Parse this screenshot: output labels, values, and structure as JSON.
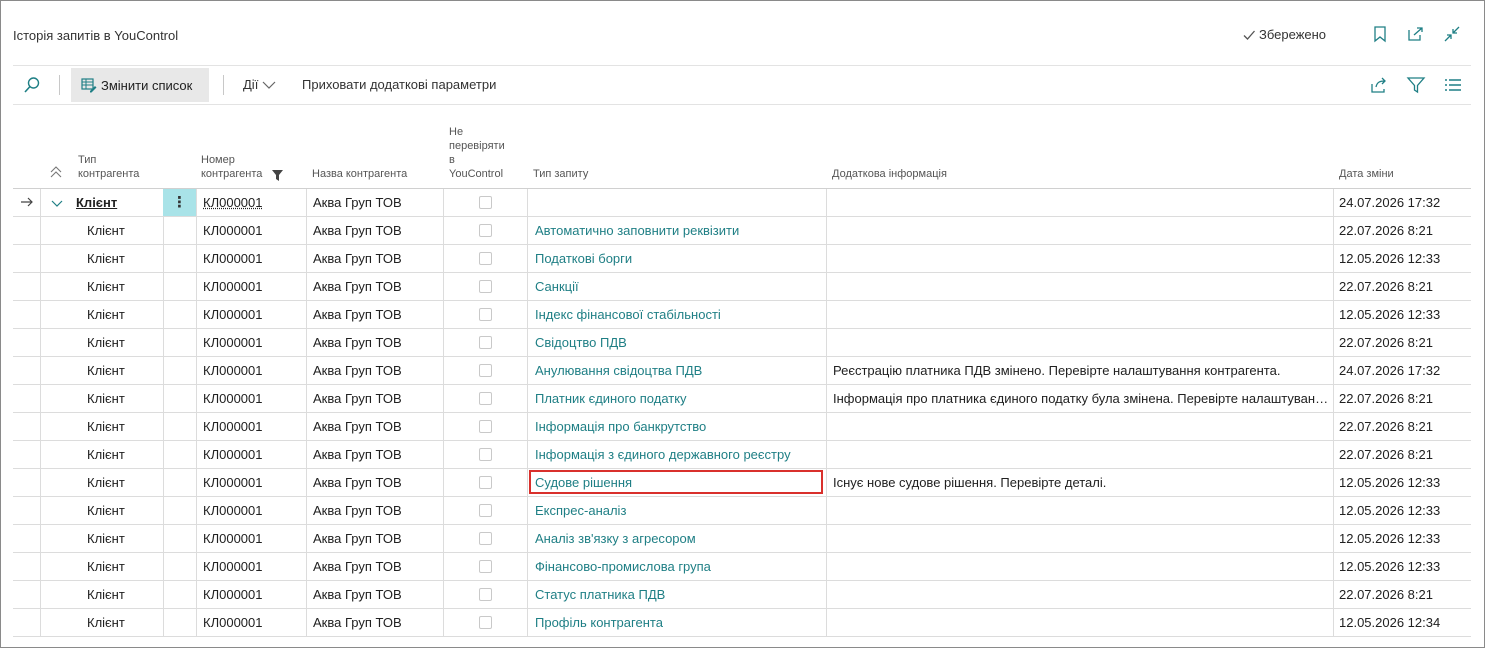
{
  "header": {
    "title": "Історія запитів в YouControl",
    "saved_label": "Збережено"
  },
  "toolbar": {
    "edit_list_label": "Змінити список",
    "actions_label": "Дії",
    "hide_params_label": "Приховати додаткові параметри"
  },
  "columns": {
    "type": "Тип контрагента",
    "number": "Номер контрагента",
    "name": "Назва контрагента",
    "nocheck_1": "Не",
    "nocheck_2": "перевіряти",
    "nocheck_3": "в",
    "nocheck_4": "YouControl",
    "request_type": "Тип запиту",
    "extra_info": "Додаткова інформація",
    "date": "Дата зміни"
  },
  "rows": [
    {
      "type": "Клієнт",
      "number": "КЛ000001",
      "name": "Аква Груп ТОВ",
      "request_type": "",
      "info": "",
      "date": "24.07.2026 17:32"
    },
    {
      "type": "Клієнт",
      "number": "КЛ000001",
      "name": "Аква Груп ТОВ",
      "request_type": "Автоматично заповнити реквізити",
      "info": "",
      "date": "22.07.2026 8:21"
    },
    {
      "type": "Клієнт",
      "number": "КЛ000001",
      "name": "Аква Груп ТОВ",
      "request_type": "Податкові борги",
      "info": "",
      "date": "12.05.2026 12:33"
    },
    {
      "type": "Клієнт",
      "number": "КЛ000001",
      "name": "Аква Груп ТОВ",
      "request_type": "Санкції",
      "info": "",
      "date": "22.07.2026 8:21"
    },
    {
      "type": "Клієнт",
      "number": "КЛ000001",
      "name": "Аква Груп ТОВ",
      "request_type": "Індекс фінансової стабільності",
      "info": "",
      "date": "12.05.2026 12:33"
    },
    {
      "type": "Клієнт",
      "number": "КЛ000001",
      "name": "Аква Груп ТОВ",
      "request_type": "Свідоцтво ПДВ",
      "info": "",
      "date": "22.07.2026 8:21"
    },
    {
      "type": "Клієнт",
      "number": "КЛ000001",
      "name": "Аква Груп ТОВ",
      "request_type": "Анулювання свідоцтва ПДВ",
      "info": "Реєстрацію платника ПДВ змінено. Перевірте налаштування контрагента.",
      "date": "24.07.2026 17:32"
    },
    {
      "type": "Клієнт",
      "number": "КЛ000001",
      "name": "Аква Груп ТОВ",
      "request_type": "Платник єдиного податку",
      "info": "Інформація про платника єдиного податку була змінена. Перевірте налаштування контрагента.",
      "date": "22.07.2026 8:21"
    },
    {
      "type": "Клієнт",
      "number": "КЛ000001",
      "name": "Аква Груп ТОВ",
      "request_type": "Інформація про банкрутство",
      "info": "",
      "date": "22.07.2026 8:21"
    },
    {
      "type": "Клієнт",
      "number": "КЛ000001",
      "name": "Аква Груп ТОВ",
      "request_type": "Інформація з єдиного державного реєстру",
      "info": "",
      "date": "22.07.2026 8:21"
    },
    {
      "type": "Клієнт",
      "number": "КЛ000001",
      "name": "Аква Груп ТОВ",
      "request_type": "Судове рішення",
      "info": "Існує нове судове рішення. Перевірте деталі.",
      "date": "12.05.2026 12:33"
    },
    {
      "type": "Клієнт",
      "number": "КЛ000001",
      "name": "Аква Груп ТОВ",
      "request_type": "Експрес-аналіз",
      "info": "",
      "date": "12.05.2026 12:33"
    },
    {
      "type": "Клієнт",
      "number": "КЛ000001",
      "name": "Аква Груп ТОВ",
      "request_type": "Аналіз зв'язку з агресором",
      "info": "",
      "date": "12.05.2026 12:33"
    },
    {
      "type": "Клієнт",
      "number": "КЛ000001",
      "name": "Аква Груп ТОВ",
      "request_type": "Фінансово-промислова група",
      "info": "",
      "date": "12.05.2026 12:33"
    },
    {
      "type": "Клієнт",
      "number": "КЛ000001",
      "name": "Аква Груп ТОВ",
      "request_type": "Статус платника ПДВ",
      "info": "",
      "date": "22.07.2026 8:21"
    },
    {
      "type": "Клієнт",
      "number": "КЛ000001",
      "name": "Аква Груп ТОВ",
      "request_type": "Профіль контрагента",
      "info": "",
      "date": "12.05.2026 12:34"
    }
  ],
  "highlight_row_index": 10,
  "colors": {
    "accent": "#1f7f85",
    "highlight_border": "#d9302c",
    "selected_cell": "#a9e3e8"
  }
}
